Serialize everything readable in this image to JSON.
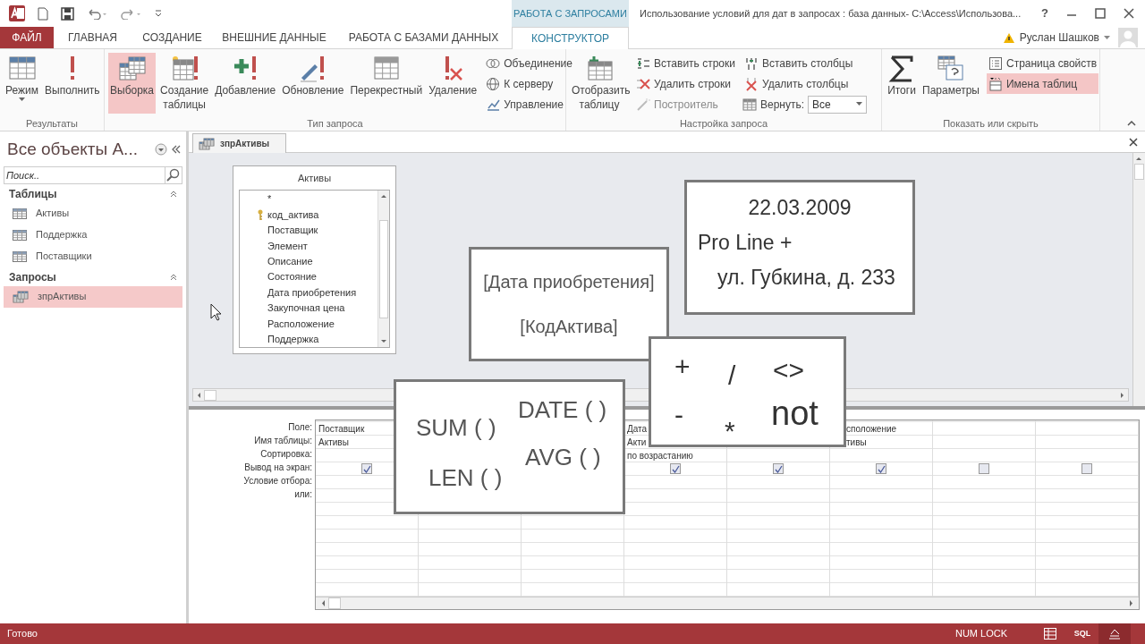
{
  "title_bar": {
    "context_tab": "РАБОТА С ЗАПРОСАМИ",
    "title": "Использование условий для дат в запросах : база данных- C:\\Access\\Использова...",
    "help": "?"
  },
  "tabs": [
    {
      "label": "ФАЙЛ",
      "kind": "file",
      "selected": false
    },
    {
      "label": "ГЛАВНАЯ",
      "kind": "tab",
      "selected": false
    },
    {
      "label": "СОЗДАНИЕ",
      "kind": "tab",
      "selected": false
    },
    {
      "label": "ВНЕШНИЕ ДАННЫЕ",
      "kind": "tab",
      "selected": false
    },
    {
      "label": "РАБОТА С БАЗАМИ ДАННЫХ",
      "kind": "tab",
      "selected": false
    },
    {
      "label": "КОНСТРУКТОР",
      "kind": "tab",
      "selected": true
    }
  ],
  "user": {
    "name": "Руслан Шашков"
  },
  "ribbon": [
    {
      "label": "Результаты",
      "items": [
        {
          "kind": "large",
          "label": "Режим",
          "dropdown": true,
          "selected": false
        },
        {
          "kind": "large",
          "label": "Выполнить",
          "selected": false
        }
      ]
    },
    {
      "label": "Тип запроса",
      "items": [
        {
          "kind": "large",
          "label": "Выборка",
          "selected": true
        },
        {
          "kind": "large",
          "label": "Создание таблицы",
          "selected": false
        },
        {
          "kind": "large",
          "label": "Добавление",
          "selected": false
        },
        {
          "kind": "large",
          "label": "Обновление",
          "selected": false
        },
        {
          "kind": "large",
          "label": "Перекрестный",
          "selected": false
        },
        {
          "kind": "large",
          "label": "Удаление",
          "selected": false
        },
        {
          "kind": "stack",
          "items": [
            {
              "kind": "button",
              "label": "Объединение",
              "selected": false,
              "disabled": false
            },
            {
              "kind": "button",
              "label": "К серверу",
              "selected": false,
              "disabled": false
            },
            {
              "kind": "button",
              "label": "Управление",
              "selected": false,
              "disabled": false
            }
          ]
        }
      ]
    },
    {
      "label": "Настройка запроса",
      "items": [
        {
          "kind": "large",
          "label": "Отобразить таблицу",
          "selected": false
        },
        {
          "kind": "stack",
          "items": [
            {
              "kind": "button",
              "label": "Вставить строки",
              "selected": false,
              "disabled": false
            },
            {
              "kind": "button",
              "label": "Удалить строки",
              "selected": false,
              "disabled": false
            },
            {
              "kind": "button",
              "label": "Построитель",
              "selected": false,
              "disabled": true
            }
          ]
        },
        {
          "kind": "stack",
          "items": [
            {
              "kind": "button",
              "label": "Вставить столбцы",
              "selected": false,
              "disabled": false
            },
            {
              "kind": "button",
              "label": "Удалить столбцы",
              "selected": false,
              "disabled": false
            },
            {
              "kind": "combo",
              "label": "Вернуть:",
              "value": "Все"
            }
          ]
        }
      ]
    },
    {
      "label": "Показать или скрыть",
      "items": [
        {
          "kind": "large",
          "label": "Итоги",
          "selected": false
        },
        {
          "kind": "large",
          "label": "Параметры",
          "selected": false
        },
        {
          "kind": "stack",
          "items": [
            {
              "kind": "button",
              "label": "Страница свойств",
              "selected": false,
              "disabled": false
            },
            {
              "kind": "button",
              "label": "Имена таблиц",
              "selected": true,
              "disabled": false
            }
          ]
        }
      ]
    }
  ],
  "nav": {
    "title": "Все объекты А...",
    "search_placeholder": "Поиск..",
    "groups": [
      {
        "label": "Таблицы",
        "expanded": true,
        "items": [
          {
            "label": "Активы",
            "kind": "table",
            "selected": false
          },
          {
            "label": "Поддержка",
            "kind": "table",
            "selected": false
          },
          {
            "label": "Поставщики",
            "kind": "table",
            "selected": false
          }
        ]
      },
      {
        "label": "Запросы",
        "expanded": true,
        "items": [
          {
            "label": "зпрАктивы",
            "kind": "query",
            "selected": true
          }
        ]
      }
    ]
  },
  "document_tab": {
    "label": "зпрАктивы"
  },
  "table_box": {
    "title": "Активы",
    "fields": [
      {
        "name": "*",
        "primary_key": false
      },
      {
        "name": "код_актива",
        "primary_key": true
      },
      {
        "name": "Поставщик",
        "primary_key": false
      },
      {
        "name": "Элемент",
        "primary_key": false
      },
      {
        "name": "Описание",
        "primary_key": false
      },
      {
        "name": "Состояние",
        "primary_key": false
      },
      {
        "name": "Дата приобретения",
        "primary_key": false
      },
      {
        "name": "Закупочная цена",
        "primary_key": false
      },
      {
        "name": "Расположение",
        "primary_key": false
      },
      {
        "name": "Поддержка",
        "primary_key": false
      }
    ]
  },
  "grid": {
    "row_labels": [
      "Поле:",
      "Имя таблицы:",
      "Сортировка:",
      "Вывод на экран:",
      "Условие отбора:",
      "или:"
    ],
    "columns": [
      {
        "kind": "open",
        "field": "Поставщик",
        "table": "Активы",
        "show": true
      },
      {
        "kind": "covered"
      },
      {
        "kind": "covered"
      },
      {
        "kind": "open",
        "field": "Дата",
        "table": "Акти",
        "sort": "по возрастанию",
        "show": true
      },
      {
        "kind": "open",
        "show": true
      },
      {
        "kind": "open",
        "field": "сположение",
        "table": "тивы",
        "show": true
      },
      {
        "kind": "open",
        "show": false
      },
      {
        "kind": "open",
        "show": false
      }
    ]
  },
  "callouts": [
    {
      "kind": "fields",
      "lines": [
        "[Дата приобретения]",
        "[КодАктива]"
      ]
    },
    {
      "kind": "sample",
      "lines": [
        "22.03.2009",
        "Pro Line +",
        "ул. Губкина, д. 233"
      ]
    },
    {
      "kind": "functions",
      "lines": [
        "SUM ( )",
        "DATE ( )",
        "LEN ( )",
        "AVG ( )"
      ]
    },
    {
      "kind": "operators",
      "lines": [
        "+",
        "/",
        "<>",
        "-",
        "*",
        "not"
      ]
    }
  ],
  "status_bar": {
    "text": "Готово",
    "indicators": [
      "NUM LOCK"
    ],
    "views": [
      {
        "kind": "datasheet",
        "selected": false
      },
      {
        "kind": "sql",
        "label": "SQL",
        "selected": false
      },
      {
        "kind": "design",
        "selected": true
      }
    ]
  }
}
